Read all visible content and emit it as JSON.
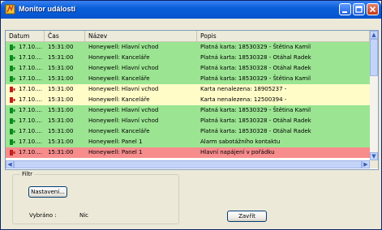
{
  "window": {
    "title": "Monitor událostí"
  },
  "columns": [
    "Datum",
    "Čas",
    "Název",
    "Popis"
  ],
  "rows": [
    {
      "date": "17.10....",
      "time": "15:31:00",
      "name": "Honeywell: Hlavní vchod",
      "desc": "Platná karta: 18530329 - Štětina Kamil",
      "color": "green",
      "icon": "door-icon"
    },
    {
      "date": "17.10....",
      "time": "15:31:00",
      "name": "Honeywell: Kanceláře",
      "desc": "Platná karta: 18530328 - Otáhal Radek",
      "color": "green",
      "icon": "door-icon"
    },
    {
      "date": "17.10....",
      "time": "15:31:00",
      "name": "Honeywell: Hlavní vchod",
      "desc": "Platná karta: 18530328 - Otáhal Radek",
      "color": "green",
      "icon": "door-icon"
    },
    {
      "date": "17.10....",
      "time": "15:31:00",
      "name": "Honeywell: Kanceláře",
      "desc": "Platná karta: 18530329 - Štětina Kamil",
      "color": "green",
      "icon": "door-icon"
    },
    {
      "date": "17.10....",
      "time": "15:31:00",
      "name": "Honeywell: Hlavní vchod",
      "desc": "Karta nenalezena: 18905237 -",
      "color": "yellow",
      "icon": "alert-door-icon"
    },
    {
      "date": "17.10....",
      "time": "15:31:00",
      "name": "Honeywell: Kanceláře",
      "desc": "Karta nenalezena: 12500394 -",
      "color": "yellow",
      "icon": "alert-door-icon"
    },
    {
      "date": "17.10....",
      "time": "15:31:00",
      "name": "Honeywell: Hlavní vchod",
      "desc": "Platná karta: 18530329 - Štětina Kamil",
      "color": "green",
      "icon": "door-icon"
    },
    {
      "date": "17.10....",
      "time": "15:31:00",
      "name": "Honeywell: Hlavní vchod",
      "desc": "Platná karta: 18530328 - Otáhal Radek",
      "color": "green",
      "icon": "door-icon"
    },
    {
      "date": "17.10....",
      "time": "15:31:00",
      "name": "Honeywell: Kanceláře",
      "desc": "Platná karta: 18530328 - Otáhal Radek",
      "color": "green",
      "icon": "door-icon"
    },
    {
      "date": "17.10....",
      "time": "15:31:00",
      "name": "Honeywell: Panel 1",
      "desc": "Alarm sabotážního kontaktu",
      "color": "green",
      "icon": "door-icon"
    },
    {
      "date": "17.10....",
      "time": "15:31:00",
      "name": "Honeywell: Panel 1",
      "desc": "Hlavní napájení v pořádku",
      "color": "red",
      "icon": "alert-door-icon"
    }
  ],
  "filter": {
    "legend": "Filtr",
    "settings_label": "Nastavení...",
    "selected_label": "Vybráno :",
    "selected_value": "Nic"
  },
  "close_label": "Zavřít",
  "colors": {
    "green": "#9be592",
    "yellow": "#fffcc8",
    "red": "#f78c8c",
    "titlebar": "#0553d0"
  }
}
